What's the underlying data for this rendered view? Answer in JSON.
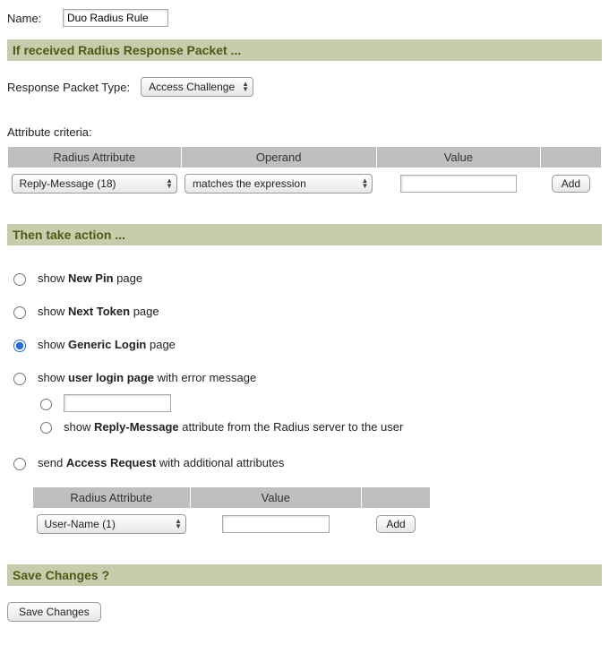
{
  "name": {
    "label": "Name:",
    "value": "Duo Radius Rule"
  },
  "section_if": "If received Radius Response Packet ...",
  "response_packet": {
    "label": "Response Packet Type:",
    "selected": "Access Challenge"
  },
  "attr_criteria_label": "Attribute criteria:",
  "criteria_headers": [
    "Radius Attribute",
    "Operand",
    "Value",
    ""
  ],
  "criteria_row": {
    "attribute": "Reply-Message (18)",
    "operand": "matches the expression",
    "value": "",
    "add": "Add"
  },
  "section_then": "Then take action ...",
  "actions": [
    {
      "pre": "show ",
      "bold": "New Pin",
      "post": " page",
      "checked": false
    },
    {
      "pre": "show ",
      "bold": "Next Token",
      "post": " page",
      "checked": false
    },
    {
      "pre": "show ",
      "bold": "Generic Login",
      "post": " page",
      "checked": true
    },
    {
      "pre": "show ",
      "bold": "user login page",
      "post": " with error message",
      "checked": false
    },
    {
      "pre": "send ",
      "bold": "Access Request",
      "post": " with additional attributes",
      "checked": false
    }
  ],
  "error_sub": {
    "custom_value": "",
    "reply_pre": "show ",
    "reply_bold": "Reply-Message",
    "reply_post": " attribute from the Radius server to the user"
  },
  "attrs2_headers": [
    "Radius Attribute",
    "Value",
    ""
  ],
  "attrs2_row": {
    "attribute": "User-Name (1)",
    "value": "",
    "add": "Add"
  },
  "section_save": "Save Changes ?",
  "save_button": "Save Changes"
}
